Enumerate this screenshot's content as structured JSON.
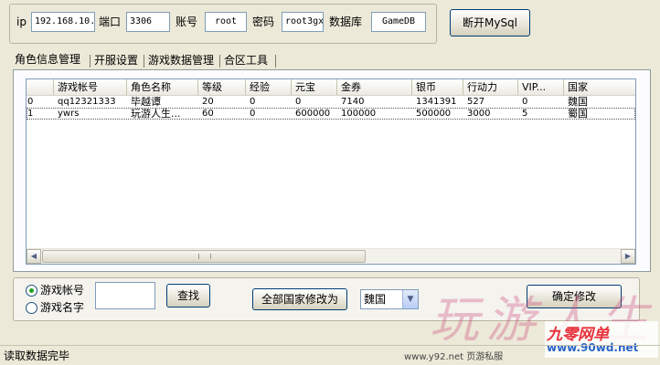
{
  "connection": {
    "ip_label": "ip",
    "ip_value": "192.168.10.",
    "port_label": "端口",
    "port_value": "3306",
    "account_label": "账号",
    "account_value": "root",
    "password_label": "密码",
    "password_value": "root3gx",
    "database_label": "数据库",
    "database_value": "GameDB",
    "disconnect_button": "断开MySql"
  },
  "tabs": [
    {
      "label": "角色信息管理",
      "active": true
    },
    {
      "label": "开服设置",
      "active": false
    },
    {
      "label": "游戏数据管理",
      "active": false
    },
    {
      "label": "合区工具",
      "active": false
    }
  ],
  "table": {
    "columns": [
      "",
      "游戏帐号",
      "角色名称",
      "等级",
      "经验",
      "元宝",
      "金券",
      "银币",
      "行动力",
      "VIP...",
      "国家"
    ],
    "rows": [
      [
        "0",
        "qq12321333",
        "毕越谭",
        "20",
        "0",
        "0",
        "7140",
        "1341391",
        "527",
        "0",
        "魏国"
      ],
      [
        "1",
        "ywrs",
        "玩游人生...",
        "60",
        "0",
        "600000",
        "100000",
        "500000",
        "3000",
        "5",
        "蜀国"
      ]
    ],
    "selected_row": 1
  },
  "search": {
    "radio_account": "游戏帐号",
    "radio_name": "游戏名字",
    "selected": "account",
    "input_value": "",
    "find_button": "查找"
  },
  "country": {
    "modify_all_button": "全部国家修改为",
    "selected_country": "魏国",
    "confirm_button": "确定修改"
  },
  "status": {
    "text": "读取数据完毕"
  },
  "watermarks": {
    "calligraphy": "玩游人生",
    "footer_site": "www.y92.net 页游私服",
    "brand_logo": "九零网单",
    "brand_url": "www.90wd.net"
  },
  "colors": {
    "window_bg": "#ece9d8",
    "brand_red": "#e8323c",
    "brand_blue": "#2a64c8",
    "radio_dot": "#21a121"
  }
}
